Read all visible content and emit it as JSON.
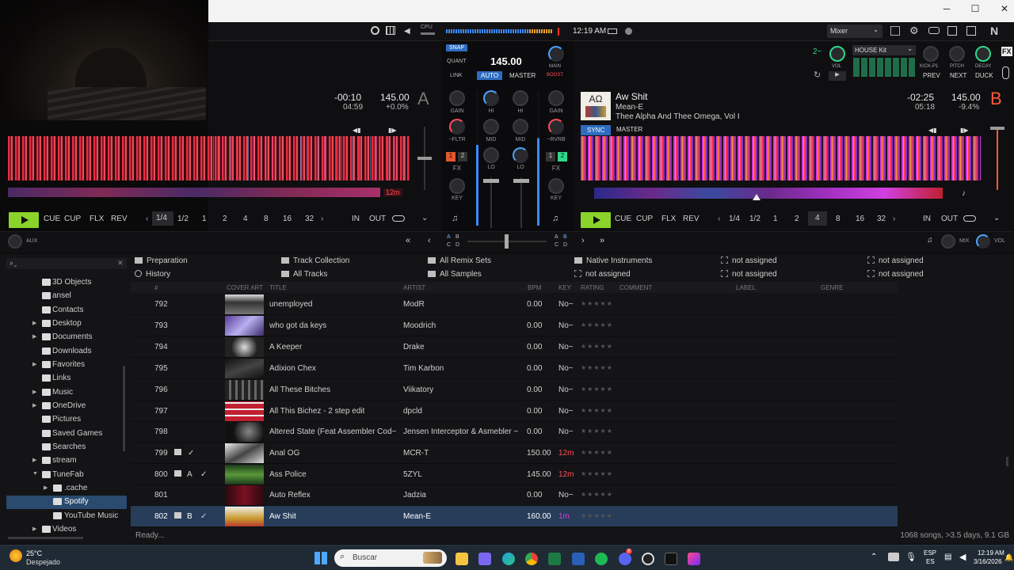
{
  "window": {
    "min": "─",
    "max": "☐",
    "close": "✕"
  },
  "topbar": {
    "cpu_label": "CPU",
    "clock": "12:19 AM",
    "layout": "Mixer"
  },
  "deckA": {
    "remaining": "-00:10",
    "total": "04:59",
    "bpm": "145.00",
    "pitch": "+0.0%",
    "letter": "A",
    "loop_len": "12m",
    "transport": {
      "cue": "CUE",
      "cup": "CUP",
      "flx": "FLX",
      "rev": "REV",
      "in": "IN",
      "out": "OUT"
    },
    "loop_sizes": [
      "1/4",
      "1/2",
      "1",
      "2",
      "4",
      "8",
      "16",
      "32"
    ]
  },
  "deckB": {
    "title": "Aw Shit",
    "artist": "Mean-E",
    "album": "Thee Alpha And Thee Omega, Vol I",
    "art_text": "ΑΩ",
    "remaining": "-02:25",
    "total": "05:18",
    "bpm": "145.00",
    "pitch": "-9.4%",
    "letter": "B",
    "sync": "SYNC",
    "master": "MASTER",
    "transport": {
      "cue": "CUE",
      "cup": "CUP",
      "flx": "FLX",
      "rev": "REV",
      "in": "IN",
      "out": "OUT"
    },
    "loop_sizes": [
      "1/4",
      "1/2",
      "1",
      "2",
      "4",
      "8",
      "16",
      "32"
    ]
  },
  "master": {
    "snap": "SNAP",
    "quant": "QUANT",
    "bpm": "145.00",
    "link": "LINK",
    "auto": "AUTO",
    "master": "MASTER",
    "main": "MAIN",
    "boost": "BOOST"
  },
  "mixer": {
    "gain": "GAIN",
    "hi": "HI",
    "mid": "MID",
    "lo": "LO",
    "key": "KEY",
    "fx": "FX",
    "fltr": "~FLTR",
    "rvrb": "~RVRB",
    "fx1": "1",
    "fx2": "2",
    "aux": "AUX",
    "mix": "MIX",
    "vol": "VOL",
    "xA": "A",
    "xB": "B",
    "xC": "C",
    "xD": "D"
  },
  "remix": {
    "deck": "2~",
    "vol": "VOL",
    "kit": "HOUSE Kit",
    "kick": "KICK-P1",
    "pitch": "PITCH",
    "decay": "DECAY",
    "prev": "PREV",
    "next": "NEXT",
    "duck": "DUCK",
    "fx": "FX"
  },
  "favorites": [
    [
      "Preparation",
      "History"
    ],
    [
      "Track Collection",
      "All Tracks"
    ],
    [
      "All Remix Sets",
      "All Samples"
    ],
    [
      "Native Instruments",
      "not assigned"
    ],
    [
      "not assigned",
      "not assigned"
    ],
    [
      "not assigned",
      "not assigned"
    ]
  ],
  "tree": [
    "3D Objects",
    "ansel",
    "Contacts",
    "Desktop",
    "Documents",
    "Downloads",
    "Favorites",
    "Links",
    "Music",
    "OneDrive",
    "Pictures",
    "Saved Games",
    "Searches",
    "stream",
    "TuneFab",
    ".cache",
    "Spotify",
    "YouTube Music",
    "Videos"
  ],
  "columns": {
    "num": "#",
    "cover": "COVER ART",
    "title": "TITLE",
    "artist": "ARTIST",
    "bpm": "BPM",
    "key": "KEY",
    "rating": "RATING",
    "comment": "COMMENT",
    "label": "LABEL",
    "genre": "GENRE"
  },
  "tracks": [
    {
      "num": "792",
      "title": "unemployed",
      "artist": "ModR",
      "bpm": "0.00",
      "key": "No~"
    },
    {
      "num": "793",
      "title": "who got da keys",
      "artist": "Moodrich",
      "bpm": "0.00",
      "key": "No~"
    },
    {
      "num": "794",
      "title": "A Keeper",
      "artist": "Drake",
      "bpm": "0.00",
      "key": "No~"
    },
    {
      "num": "795",
      "title": "Adixion Chex",
      "artist": "Tim Karbon",
      "bpm": "0.00",
      "key": "No~"
    },
    {
      "num": "796",
      "title": "All These Bitches",
      "artist": "Viikatory",
      "bpm": "0.00",
      "key": "No~"
    },
    {
      "num": "797",
      "title": "All This Bichez - 2 step edit",
      "artist": "dpcld",
      "bpm": "0.00",
      "key": "No~"
    },
    {
      "num": "798",
      "title": "Altered State (Feat Assembler Cod~",
      "artist": "Jensen Interceptor & Asmebler ~",
      "bpm": "0.00",
      "key": "No~"
    },
    {
      "num": "799",
      "title": "Anal OG",
      "artist": "MCR-T",
      "bpm": "150.00",
      "key": "12m",
      "deck": ""
    },
    {
      "num": "800",
      "title": "Ass Police",
      "artist": "5ZYL",
      "bpm": "145.00",
      "key": "12m",
      "deck": "A"
    },
    {
      "num": "801",
      "title": "Auto Reflex",
      "artist": "Jadzia",
      "bpm": "0.00",
      "key": "No~"
    },
    {
      "num": "802",
      "title": "Aw Shit",
      "artist": "Mean-E",
      "bpm": "160.00",
      "key": "1m",
      "deck": "B"
    }
  ],
  "status": {
    "left": "Ready...",
    "right": "1068 songs, >3.5 days, 9.1 GB"
  },
  "taskbar": {
    "temp": "25°C",
    "weather": "Despejado",
    "search": "Buscar",
    "lang1": "ESP",
    "lang2": "ES",
    "time": "12:19 AM",
    "date": "3/16/2026",
    "badge": "8"
  }
}
